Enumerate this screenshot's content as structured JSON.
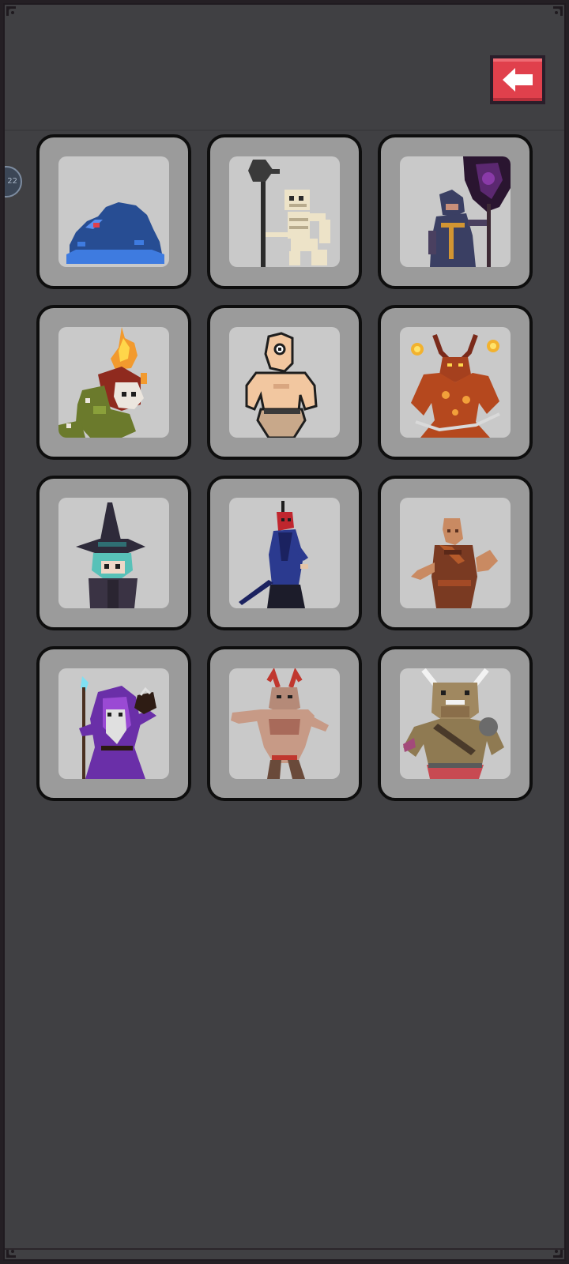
{
  "screen": {
    "background": "#404043",
    "side_badge": {
      "text": "22"
    }
  },
  "back_button": {
    "icon": "arrow-left-icon",
    "color": "#e0404c"
  },
  "units": [
    {
      "id": "blue-slime",
      "icon": "blue-slime-icon"
    },
    {
      "id": "skeleton-halberd",
      "icon": "skeleton-warrior-icon"
    },
    {
      "id": "dark-cultist",
      "icon": "hooded-cultist-icon"
    },
    {
      "id": "fire-serpent",
      "icon": "flame-serpent-icon"
    },
    {
      "id": "cyclops",
      "icon": "cyclops-icon"
    },
    {
      "id": "fire-demon",
      "icon": "fire-demon-icon"
    },
    {
      "id": "witch",
      "icon": "witch-icon"
    },
    {
      "id": "oni-samurai",
      "icon": "oni-samurai-icon"
    },
    {
      "id": "monk",
      "icon": "monk-icon"
    },
    {
      "id": "archmage",
      "icon": "archmage-icon"
    },
    {
      "id": "horned-brute",
      "icon": "horned-brute-icon"
    },
    {
      "id": "minotaur",
      "icon": "minotaur-icon"
    }
  ]
}
